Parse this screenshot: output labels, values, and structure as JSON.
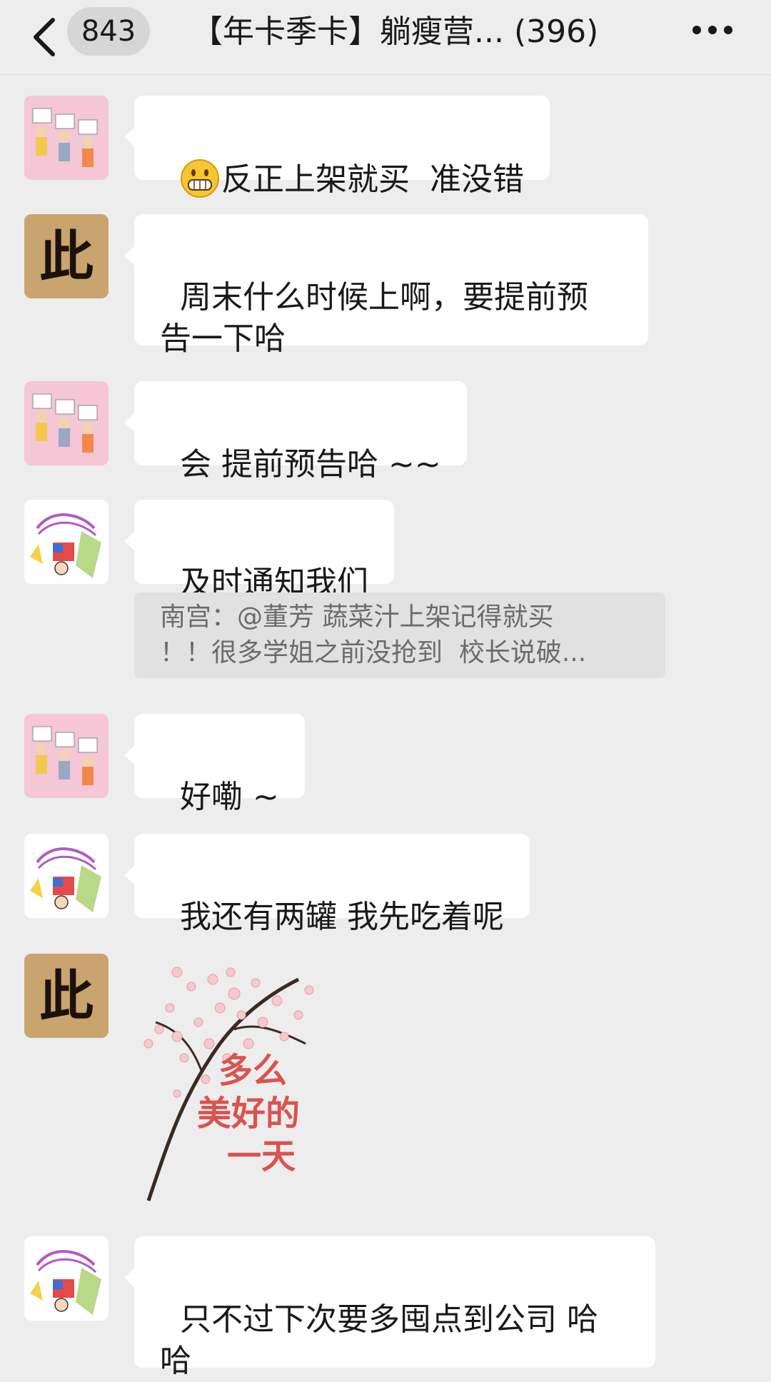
{
  "header": {
    "unread_count": "843",
    "title": "【年卡季卡】躺瘦营... (396)"
  },
  "messages": [
    {
      "text": "反正上架就买  准没错",
      "emoji": "grinning-face"
    },
    {
      "text": "周末什么时候上啊，要提前预\n告一下哈"
    },
    {
      "text": "会 提前预告哈 ~~"
    },
    {
      "text": "及时通知我们"
    },
    {
      "text": "好嘞 ~"
    },
    {
      "text": "我还有两罐 我先吃着呢"
    },
    {
      "text": "只不过下次要多囤点到公司 哈\n哈"
    }
  ],
  "quote": {
    "text": "南宫：@董芳 蔬菜汁上架记得就买\n！！很多学姐之前没抢到  校长说破..."
  },
  "avatars": {
    "av_glyph": "此"
  },
  "sticker": {
    "line1": "多么",
    "line2": "美好的",
    "line3": "一天"
  },
  "colors": {
    "background": "#ededed",
    "bubble": "#ffffff",
    "quote_bg": "#e1e1e1",
    "sticker_text": "#d9534f"
  }
}
